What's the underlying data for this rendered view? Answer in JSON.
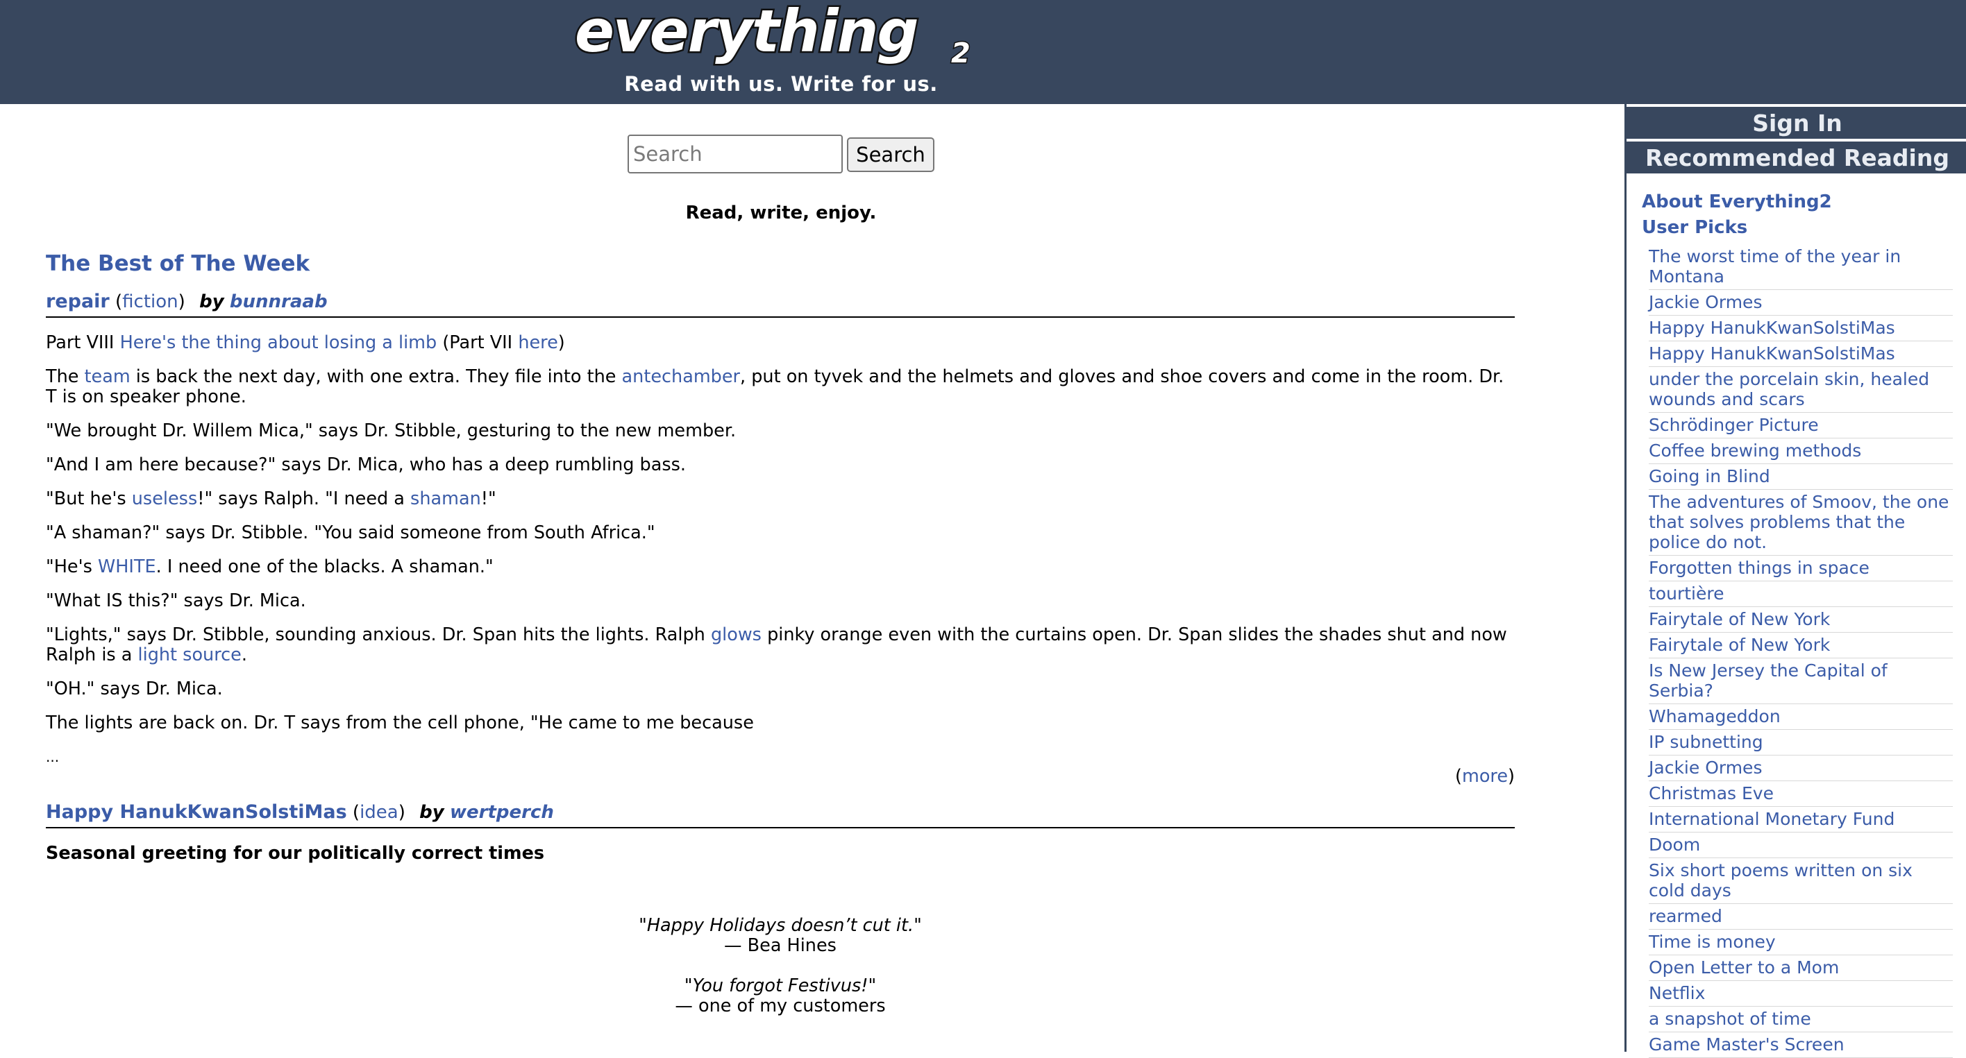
{
  "header": {
    "logo_text": "everything2",
    "tagline": "Read with us. Write for us."
  },
  "search": {
    "placeholder": "Search",
    "button_label": "Search"
  },
  "motto": "Read, write, enjoy.",
  "best_of_week": {
    "title": "The Best of The Week",
    "writeups": [
      {
        "title": "repair",
        "type": "fiction",
        "by": "by",
        "author": "bunnraab",
        "intro": {
          "prefix": "Part VIII ",
          "link1": "Here's the thing about losing a limb",
          "middle": " (Part VII ",
          "link2": "here",
          "suffix": ")"
        },
        "p1": {
          "a": "The ",
          "link_team": "team",
          "b": " is back the next day, with one extra. They file into the ",
          "link_antechamber": "antechamber",
          "c": ", put on tyvek and the helmets and gloves and shoe covers and come in the room. Dr. T is on speaker phone."
        },
        "p2": "\"We brought Dr. Willem Mica,\" says Dr. Stibble, gesturing to the new member.",
        "p3": "\"And I am here because?\" says Dr. Mica, who has a deep rumbling bass.",
        "p4": {
          "a": "\"But he's ",
          "link_useless": "useless",
          "b": "!\" says Ralph. \"I need a ",
          "link_shaman": "shaman",
          "c": "!\""
        },
        "p5": "\"A shaman?\" says Dr. Stibble. \"You said someone from South Africa.\"",
        "p6": {
          "a": "\"He's ",
          "link_white": "WHITE",
          "b": ". I need one of the blacks. A shaman.\""
        },
        "p7": "\"What IS this?\" says Dr. Mica.",
        "p8": {
          "a": "\"Lights,\" says Dr. Stibble, sounding anxious. Dr. Span hits the lights. Ralph ",
          "link_glows": "glows",
          "b": " pinky orange even with the curtains open. Dr. Span slides the shades shut and now Ralph is a ",
          "link_light_source": "light source",
          "c": "."
        },
        "p9": "\"OH.\" says Dr. Mica.",
        "p10": "The lights are back on. Dr. T says from the cell phone, \"He came to me because",
        "ellipsis": "...",
        "more_label": "more"
      },
      {
        "title": "Happy HanukKwanSolstiMas",
        "type": "idea",
        "by": "by",
        "author": "wertperch",
        "subtitle": "Seasonal greeting for our politically correct times",
        "quotes": [
          {
            "quote": "\"Happy Holidays doesn’t cut it.\"",
            "attribution": "— Bea Hines"
          },
          {
            "quote": "\"You forgot Festivus!\"",
            "attribution": "— one of my customers"
          }
        ]
      }
    ]
  },
  "sidebar": {
    "sign_in": "Sign In",
    "recommended_reading": "Recommended Reading",
    "about": "About Everything2",
    "user_picks": "User Picks",
    "items": [
      "The worst time of the year in Montana",
      "Jackie Ormes",
      "Happy HanukKwanSolstiMas",
      "Happy HanukKwanSolstiMas",
      "under the porcelain skin, healed wounds and scars",
      "Schrödinger Picture",
      "Coffee brewing methods",
      "Going in Blind",
      "The adventures of Smoov, the one that solves problems that the police do not.",
      "Forgotten things in space",
      "tourtière",
      "Fairytale of New York",
      "Fairytale of New York",
      "Is New Jersey the Capital of Serbia?",
      "Whamageddon",
      "IP subnetting",
      "Jackie Ormes",
      "Christmas Eve",
      "International Monetary Fund",
      "Doom",
      "Six short poems written on six cold days",
      "rearmed",
      "Time is money",
      "Open Letter to a Mom",
      "Netflix",
      "a snapshot of time",
      "Game Master's Screen"
    ]
  },
  "colors": {
    "header_bg": "#38475e",
    "link": "#3b5ca8"
  }
}
